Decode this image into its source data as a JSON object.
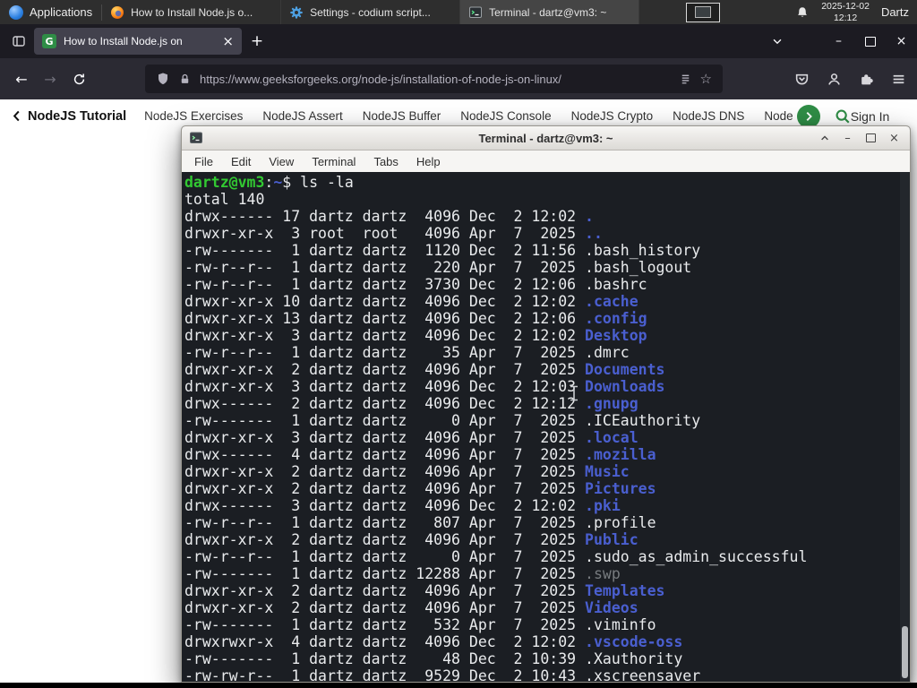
{
  "panel": {
    "applications_label": "Applications",
    "tasks": [
      {
        "title": "How to Install Node.js o...",
        "icon": "firefox-icon"
      },
      {
        "title": "Settings - codium script...",
        "icon": "settings-gear-icon"
      },
      {
        "title": "Terminal - dartz@vm3: ~",
        "icon": "terminal-icon"
      }
    ],
    "clock": {
      "date": "2025-12-02",
      "time": "12:12"
    },
    "user_label": "Dartz"
  },
  "browser": {
    "tab": {
      "title": "How to Install Node.js on"
    },
    "url": "https://www.geeksforgeeks.org/node-js/installation-of-node-js-on-linux/",
    "site_nav": {
      "back_label": "NodeJS Tutorial",
      "links": [
        "NodeJS Exercises",
        "NodeJS Assert",
        "NodeJS Buffer",
        "NodeJS Console",
        "NodeJS Crypto",
        "NodeJS DNS",
        "Node"
      ],
      "sign_in_label": "Sign In"
    }
  },
  "terminal": {
    "title": "Terminal - dartz@vm3: ~",
    "menu": [
      "File",
      "Edit",
      "View",
      "Terminal",
      "Tabs",
      "Help"
    ],
    "prompt": {
      "user_host": "dartz@vm3",
      "separator": ":",
      "path": "~",
      "symbol": "$"
    },
    "command": "ls -la",
    "total_line": "total 140",
    "listing": [
      {
        "perms": "drwx------",
        "links": 17,
        "owner": "dartz",
        "group": "dartz",
        "size": 4096,
        "month": "Dec",
        "day": 2,
        "time": "12:02",
        "name": ".",
        "type": "dir"
      },
      {
        "perms": "drwxr-xr-x",
        "links": 3,
        "owner": "root",
        "group": "root",
        "size": 4096,
        "month": "Apr",
        "day": 7,
        "time": "2025",
        "name": "..",
        "type": "dir"
      },
      {
        "perms": "-rw-------",
        "links": 1,
        "owner": "dartz",
        "group": "dartz",
        "size": 1120,
        "month": "Dec",
        "day": 2,
        "time": "11:56",
        "name": ".bash_history",
        "type": "file"
      },
      {
        "perms": "-rw-r--r--",
        "links": 1,
        "owner": "dartz",
        "group": "dartz",
        "size": 220,
        "month": "Apr",
        "day": 7,
        "time": "2025",
        "name": ".bash_logout",
        "type": "file"
      },
      {
        "perms": "-rw-r--r--",
        "links": 1,
        "owner": "dartz",
        "group": "dartz",
        "size": 3730,
        "month": "Dec",
        "day": 2,
        "time": "12:06",
        "name": ".bashrc",
        "type": "file"
      },
      {
        "perms": "drwxr-xr-x",
        "links": 10,
        "owner": "dartz",
        "group": "dartz",
        "size": 4096,
        "month": "Dec",
        "day": 2,
        "time": "12:02",
        "name": ".cache",
        "type": "dir"
      },
      {
        "perms": "drwxr-xr-x",
        "links": 13,
        "owner": "dartz",
        "group": "dartz",
        "size": 4096,
        "month": "Dec",
        "day": 2,
        "time": "12:06",
        "name": ".config",
        "type": "dir"
      },
      {
        "perms": "drwxr-xr-x",
        "links": 3,
        "owner": "dartz",
        "group": "dartz",
        "size": 4096,
        "month": "Dec",
        "day": 2,
        "time": "12:02",
        "name": "Desktop",
        "type": "dir"
      },
      {
        "perms": "-rw-r--r--",
        "links": 1,
        "owner": "dartz",
        "group": "dartz",
        "size": 35,
        "month": "Apr",
        "day": 7,
        "time": "2025",
        "name": ".dmrc",
        "type": "file"
      },
      {
        "perms": "drwxr-xr-x",
        "links": 2,
        "owner": "dartz",
        "group": "dartz",
        "size": 4096,
        "month": "Apr",
        "day": 7,
        "time": "2025",
        "name": "Documents",
        "type": "dir"
      },
      {
        "perms": "drwxr-xr-x",
        "links": 3,
        "owner": "dartz",
        "group": "dartz",
        "size": 4096,
        "month": "Dec",
        "day": 2,
        "time": "12:03",
        "name": "Downloads",
        "type": "dir"
      },
      {
        "perms": "drwx------",
        "links": 2,
        "owner": "dartz",
        "group": "dartz",
        "size": 4096,
        "month": "Dec",
        "day": 2,
        "time": "12:12",
        "name": ".gnupg",
        "type": "dir"
      },
      {
        "perms": "-rw-------",
        "links": 1,
        "owner": "dartz",
        "group": "dartz",
        "size": 0,
        "month": "Apr",
        "day": 7,
        "time": "2025",
        "name": ".ICEauthority",
        "type": "file"
      },
      {
        "perms": "drwxr-xr-x",
        "links": 3,
        "owner": "dartz",
        "group": "dartz",
        "size": 4096,
        "month": "Apr",
        "day": 7,
        "time": "2025",
        "name": ".local",
        "type": "dir"
      },
      {
        "perms": "drwx------",
        "links": 4,
        "owner": "dartz",
        "group": "dartz",
        "size": 4096,
        "month": "Apr",
        "day": 7,
        "time": "2025",
        "name": ".mozilla",
        "type": "dir"
      },
      {
        "perms": "drwxr-xr-x",
        "links": 2,
        "owner": "dartz",
        "group": "dartz",
        "size": 4096,
        "month": "Apr",
        "day": 7,
        "time": "2025",
        "name": "Music",
        "type": "dir"
      },
      {
        "perms": "drwxr-xr-x",
        "links": 2,
        "owner": "dartz",
        "group": "dartz",
        "size": 4096,
        "month": "Apr",
        "day": 7,
        "time": "2025",
        "name": "Pictures",
        "type": "dir"
      },
      {
        "perms": "drwx------",
        "links": 3,
        "owner": "dartz",
        "group": "dartz",
        "size": 4096,
        "month": "Dec",
        "day": 2,
        "time": "12:02",
        "name": ".pki",
        "type": "dir"
      },
      {
        "perms": "-rw-r--r--",
        "links": 1,
        "owner": "dartz",
        "group": "dartz",
        "size": 807,
        "month": "Apr",
        "day": 7,
        "time": "2025",
        "name": ".profile",
        "type": "file"
      },
      {
        "perms": "drwxr-xr-x",
        "links": 2,
        "owner": "dartz",
        "group": "dartz",
        "size": 4096,
        "month": "Apr",
        "day": 7,
        "time": "2025",
        "name": "Public",
        "type": "dir"
      },
      {
        "perms": "-rw-r--r--",
        "links": 1,
        "owner": "dartz",
        "group": "dartz",
        "size": 0,
        "month": "Apr",
        "day": 7,
        "time": "2025",
        "name": ".sudo_as_admin_successful",
        "type": "file"
      },
      {
        "perms": "-rw-------",
        "links": 1,
        "owner": "dartz",
        "group": "dartz",
        "size": 12288,
        "month": "Apr",
        "day": 7,
        "time": "2025",
        "name": ".swp",
        "type": "dim"
      },
      {
        "perms": "drwxr-xr-x",
        "links": 2,
        "owner": "dartz",
        "group": "dartz",
        "size": 4096,
        "month": "Apr",
        "day": 7,
        "time": "2025",
        "name": "Templates",
        "type": "dir"
      },
      {
        "perms": "drwxr-xr-x",
        "links": 2,
        "owner": "dartz",
        "group": "dartz",
        "size": 4096,
        "month": "Apr",
        "day": 7,
        "time": "2025",
        "name": "Videos",
        "type": "dir"
      },
      {
        "perms": "-rw-------",
        "links": 1,
        "owner": "dartz",
        "group": "dartz",
        "size": 532,
        "month": "Apr",
        "day": 7,
        "time": "2025",
        "name": ".viminfo",
        "type": "file"
      },
      {
        "perms": "drwxrwxr-x",
        "links": 4,
        "owner": "dartz",
        "group": "dartz",
        "size": 4096,
        "month": "Dec",
        "day": 2,
        "time": "12:02",
        "name": ".vscode-oss",
        "type": "dir"
      },
      {
        "perms": "-rw-------",
        "links": 1,
        "owner": "dartz",
        "group": "dartz",
        "size": 48,
        "month": "Dec",
        "day": 2,
        "time": "10:39",
        "name": ".Xauthority",
        "type": "file"
      },
      {
        "perms": "-rw-rw-r--",
        "links": 1,
        "owner": "dartz",
        "group": "dartz",
        "size": 9529,
        "month": "Dec",
        "day": 2,
        "time": "10:43",
        "name": ".xscreensaver",
        "type": "file"
      }
    ]
  },
  "icons": {
    "back": "←",
    "forward": "→",
    "new_tab": "+",
    "tab_close": "×",
    "close": "×",
    "minimize": "–",
    "star": "☆"
  },
  "colors": {
    "gfg_green": "#2f8d46",
    "panel_bg": "#2e2e2e",
    "browser_tabbar_bg": "#1c1b22",
    "browser_toolbar_bg": "#2b2a33",
    "terminal_bg": "#1b1e23",
    "terminal_text": "#e9ebed",
    "terminal_green": "#32c932",
    "terminal_blue": "#4a5fd0",
    "terminal_dim": "#777b7f"
  }
}
